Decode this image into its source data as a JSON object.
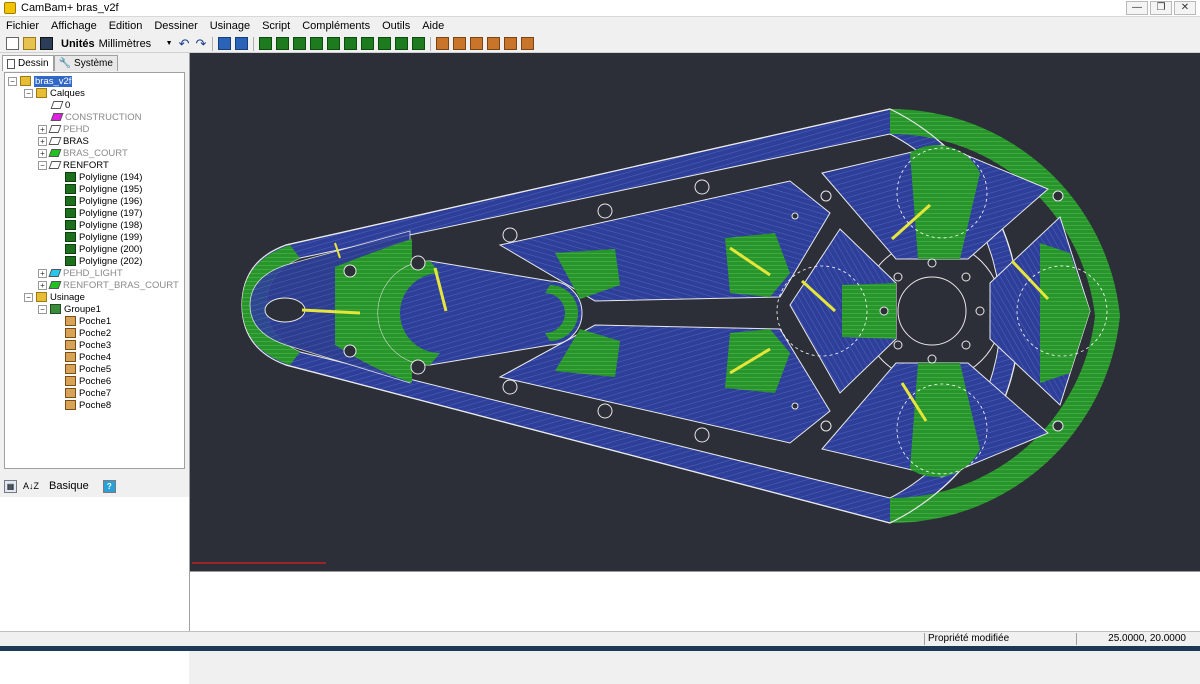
{
  "window": {
    "title": "CamBam+  bras_v2f",
    "minimize_label": "—",
    "maximize_label": "❐",
    "close_label": "✕"
  },
  "menu": [
    "Fichier",
    "Affichage",
    "Edition",
    "Dessiner",
    "Usinage",
    "Script",
    "Compléments",
    "Outils",
    "Aide"
  ],
  "toolbar": {
    "units_label": "Unités",
    "units_value": "Millimètres",
    "undo_icon": "↶",
    "redo_icon": "↷"
  },
  "left_panel": {
    "tabs": [
      "Dessin",
      "Système"
    ],
    "tree": {
      "root": "bras_v2f",
      "calques": "Calques",
      "layers": [
        {
          "name": "0",
          "color": "#ffffff",
          "dim": false
        },
        {
          "name": "CONSTRUCTION",
          "color": "#e020e0",
          "dim": true
        },
        {
          "name": "PEHD",
          "color": "#ffffff",
          "dim": true
        },
        {
          "name": "BRAS",
          "color": "#ffffff",
          "dim": false
        },
        {
          "name": "BRAS_COURT",
          "color": "#1fc21f",
          "dim": true
        },
        {
          "name": "RENFORT",
          "color": "#ffffff",
          "dim": false
        }
      ],
      "polylines": [
        "Polyligne (194)",
        "Polyligne (195)",
        "Polyligne (196)",
        "Polyligne (197)",
        "Polyligne (198)",
        "Polyligne (199)",
        "Polyligne (200)",
        "Polyligne (202)"
      ],
      "layers_after": [
        {
          "name": "PEHD_LIGHT",
          "color": "#27c8ec",
          "dim": true
        },
        {
          "name": "RENFORT_BRAS_COURT",
          "color": "#1fc21f",
          "dim": true
        }
      ],
      "usinage": "Usinage",
      "groupe": "Groupe1",
      "poches": [
        "Poche1",
        "Poche2",
        "Poche3",
        "Poche4",
        "Poche5",
        "Poche6",
        "Poche7",
        "Poche8"
      ]
    },
    "props_mode": "Basique",
    "props_help": "?",
    "az_icon": "A↓Z"
  },
  "status": {
    "message": "Propriété modifiée",
    "coords": "25.0000, 20.0000"
  },
  "colors": {
    "canvas_bg": "#2c2f38",
    "pocket_blue": "#2e3f9a",
    "pocket_green": "#2b9a2b",
    "outline": "#e8e8e8",
    "toolpath_yellow": "#e6e63a"
  }
}
